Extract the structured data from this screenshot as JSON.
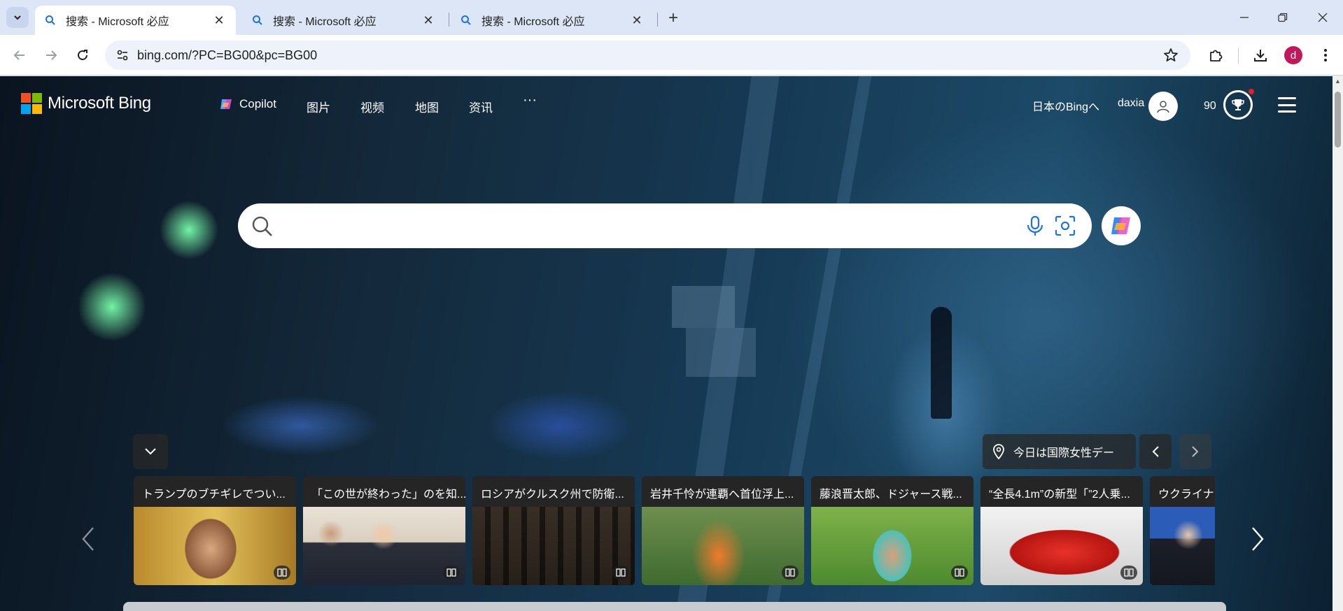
{
  "browser": {
    "tabs": [
      {
        "title": "搜索 - Microsoft 必应",
        "active": true
      },
      {
        "title": "搜索 - Microsoft 必应",
        "active": false
      },
      {
        "title": "搜索 - Microsoft 必应",
        "active": false
      }
    ],
    "url": "bing.com/?PC=BG00&pc=BG00",
    "profile_initial": "d",
    "profile_color": "#c2185b"
  },
  "bing": {
    "logo_text": "Microsoft Bing",
    "nav": {
      "copilot": "Copilot",
      "images": "图片",
      "videos": "视频",
      "maps": "地图",
      "news": "资讯",
      "more": "···"
    },
    "region_link": "日本のBingへ",
    "username": "daxia",
    "reward_points": "90",
    "search": {
      "placeholder": ""
    },
    "info_pill": "今日は国際女性デー",
    "news_cards": [
      {
        "headline": "トランプのブチギレでつい...",
        "thumb": "zelensky-portrait"
      },
      {
        "headline": "「この世が終わった」のを知...",
        "thumb": "oval-office-meeting"
      },
      {
        "headline": "ロシアがクルスク州で防衛...",
        "thumb": "damaged-building"
      },
      {
        "headline": "岩井千怜が連覇へ首位浮上...",
        "thumb": "golfer"
      },
      {
        "headline": "藤浪晋太郎、ドジャース戦...",
        "thumb": "baseball-player"
      },
      {
        "headline": "“全長4.1m”の新型「”2人乗...",
        "thumb": "red-sports-car"
      },
      {
        "headline": "ウクライナ",
        "thumb": "man-in-suit"
      }
    ]
  },
  "colors": {
    "ms_red": "#f25022",
    "ms_green": "#7fba00",
    "ms_blue": "#00a4ef",
    "ms_yellow": "#ffb900",
    "tabstrip_bg": "#dde6f6"
  }
}
